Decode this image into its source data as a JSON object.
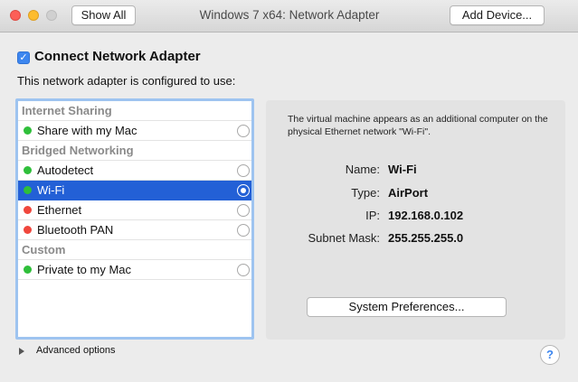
{
  "window": {
    "title": "Windows 7 x64: Network Adapter",
    "show_all_label": "Show All",
    "add_device_label": "Add Device..."
  },
  "connect": {
    "label": "Connect Network Adapter",
    "checked": true
  },
  "configured_label": "This network adapter is configured to use:",
  "groups": [
    {
      "header": "Internet Sharing",
      "items": [
        {
          "label": "Share with my Mac",
          "status_color": "#2fbf3a",
          "selected": false
        }
      ]
    },
    {
      "header": "Bridged Networking",
      "items": [
        {
          "label": "Autodetect",
          "status_color": "#2fbf3a",
          "selected": false
        },
        {
          "label": "Wi-Fi",
          "status_color": "#2fbf3a",
          "selected": true
        },
        {
          "label": "Ethernet",
          "status_color": "#f0473d",
          "selected": false
        },
        {
          "label": "Bluetooth PAN",
          "status_color": "#f0473d",
          "selected": false
        }
      ]
    },
    {
      "header": "Custom",
      "items": [
        {
          "label": "Private to my Mac",
          "status_color": "#2fbf3a",
          "selected": false
        }
      ]
    }
  ],
  "info": {
    "description": "The virtual machine appears as an additional computer on the physical Ethernet network \"Wi-Fi\".",
    "name_key": "Name:",
    "name_value": "Wi-Fi",
    "type_key": "Type:",
    "type_value": "AirPort",
    "ip_key": "IP:",
    "ip_value": "192.168.0.102",
    "mask_key": "Subnet Mask:",
    "mask_value": "255.255.255.0",
    "system_prefs_label": "System Preferences..."
  },
  "advanced_label": "Advanced options",
  "help_label": "?",
  "colors": {
    "selection": "#2360d6",
    "focus_ring": "#9ec4f0",
    "status_green": "#2fbf3a",
    "status_red": "#f0473d"
  }
}
